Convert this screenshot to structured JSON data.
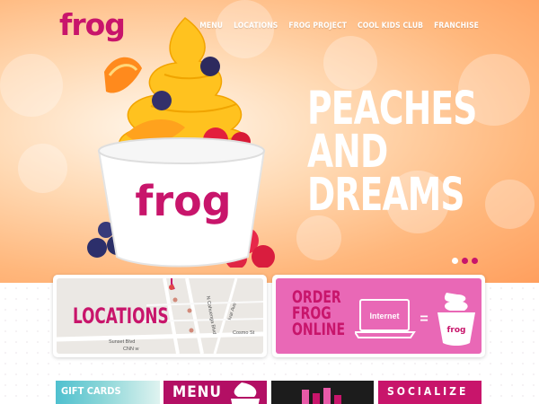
{
  "brand": {
    "logo_text": "frog",
    "cup_text": "frog",
    "mini_cup_text": "frog"
  },
  "nav": {
    "items": [
      {
        "label": "MENU"
      },
      {
        "label": "LOCATIONS"
      },
      {
        "label": "FROG PROJECT"
      },
      {
        "label": "COOL KIDS CLUB"
      },
      {
        "label": "FRANCHISE"
      }
    ]
  },
  "hero": {
    "headline_lines": [
      "PEACHES",
      "AND",
      "DREAMS"
    ],
    "carousel": {
      "total": 3,
      "active": 2
    }
  },
  "locations_card": {
    "title": "LOCATIONS",
    "street_labels": [
      "Sunset Blvd",
      "N Cahuenga Blvd",
      "Ivar Ave",
      "Cosmo St",
      "CNN w"
    ]
  },
  "order_card": {
    "title_lines": [
      "ORDER",
      "FROG",
      "ONLINE"
    ],
    "screen_text": "Internet",
    "equals_sign": "="
  },
  "tiles": {
    "gift_cards": "GIFT CARDS",
    "menu": "MENU",
    "socialize": "SOCIALIZE"
  },
  "colors": {
    "brand_pink": "#c8156b",
    "order_bg": "#e968b6",
    "hero_peach": "#ffb77c",
    "gift_teal": "#4fc0cf",
    "dark_tile": "#1c1c1c"
  }
}
